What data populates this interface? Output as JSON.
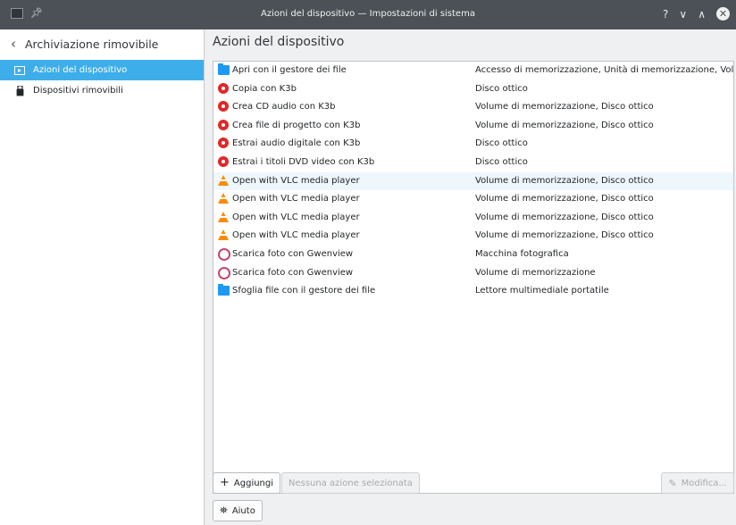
{
  "window": {
    "title": "Azioni del dispositivo — Impostazioni di sistema",
    "help_glyph": "?",
    "minimize_glyph": "∨",
    "maximize_glyph": "∧",
    "close_glyph": "✕"
  },
  "sidebar": {
    "back_label": "Archiviazione rimovibile",
    "items": [
      {
        "label": "Azioni del dispositivo",
        "selected": true,
        "icon": "device-actions-icon"
      },
      {
        "label": "Dispositivi rimovibili",
        "selected": false,
        "icon": "usb-drive-icon"
      }
    ]
  },
  "main": {
    "title": "Azioni del dispositivo",
    "actions": [
      {
        "name": "Apri con il gestore dei file",
        "type": "Accesso di memorizzazione, Unità di memorizzazione, Vol...",
        "icon": "folder-icon"
      },
      {
        "name": "Copia con K3b",
        "type": "Disco ottico",
        "icon": "k3b-icon"
      },
      {
        "name": "Crea CD audio con K3b",
        "type": "Volume di memorizzazione, Disco ottico",
        "icon": "k3b-icon"
      },
      {
        "name": "Crea file di progetto con K3b",
        "type": "Volume di memorizzazione, Disco ottico",
        "icon": "k3b-icon"
      },
      {
        "name": "Estrai audio digitale con K3b",
        "type": "Disco ottico",
        "icon": "k3b-icon"
      },
      {
        "name": "Estrai i titoli DVD video con K3b",
        "type": "Disco ottico",
        "icon": "k3b-icon"
      },
      {
        "name": "Open with VLC media player",
        "type": "Volume di memorizzazione, Disco ottico",
        "icon": "vlc-icon"
      },
      {
        "name": "Open with VLC media player",
        "type": "Volume di memorizzazione, Disco ottico",
        "icon": "vlc-icon"
      },
      {
        "name": "Open with VLC media player",
        "type": "Volume di memorizzazione, Disco ottico",
        "icon": "vlc-icon"
      },
      {
        "name": "Open with VLC media player",
        "type": "Volume di memorizzazione, Disco ottico",
        "icon": "vlc-icon"
      },
      {
        "name": "Scarica foto con Gwenview",
        "type": "Macchina fotografica",
        "icon": "gwenview-icon"
      },
      {
        "name": "Scarica foto con Gwenview",
        "type": "Volume di memorizzazione",
        "icon": "gwenview-icon"
      },
      {
        "name": "Sfoglia file con il gestore dei file",
        "type": "Lettore multimediale portatile",
        "icon": "folder-icon"
      }
    ],
    "buttons": {
      "add": "Aggiungi",
      "none_selected": "Nessuna azione selezionata",
      "edit": "Modifica...",
      "help": "Aiuto"
    }
  },
  "colors": {
    "accent": "#3daee9",
    "titlebar": "#4b5157",
    "window_bg": "#eff0f1"
  }
}
